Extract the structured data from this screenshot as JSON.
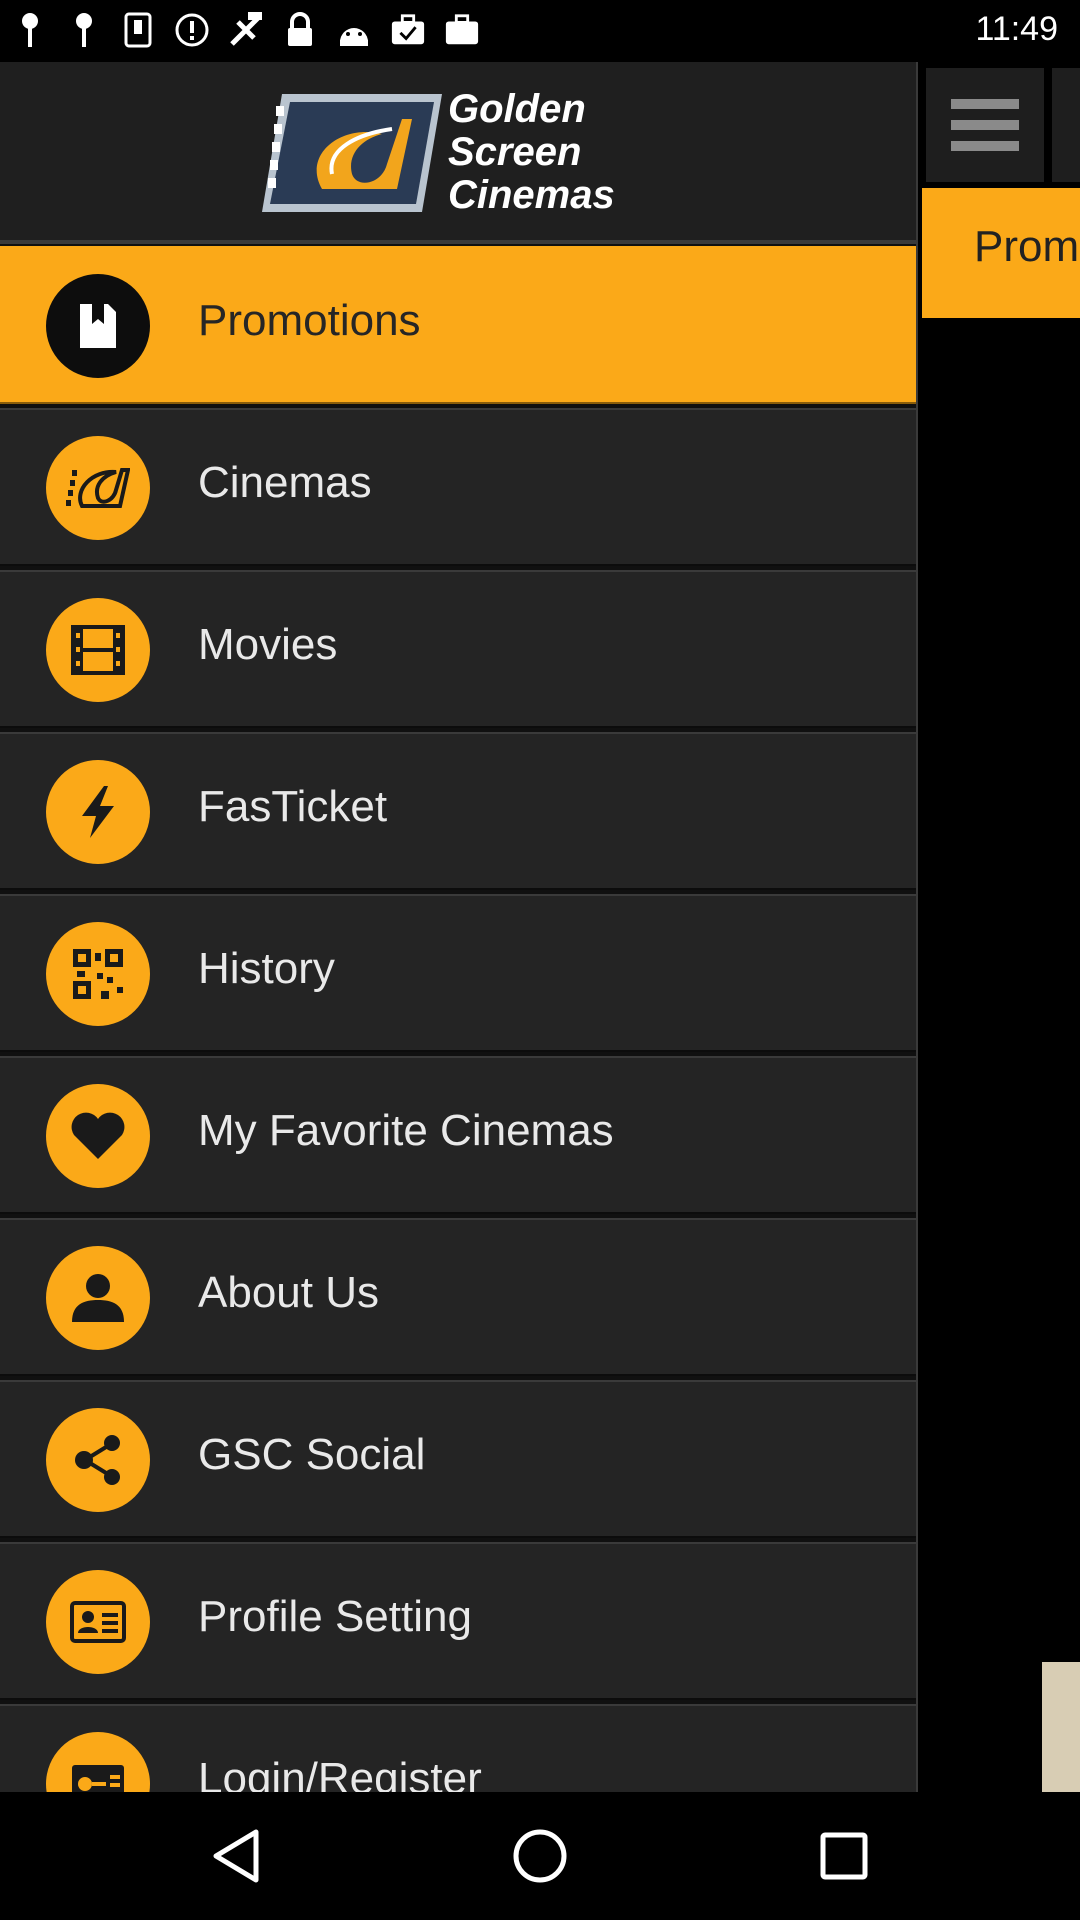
{
  "status_bar": {
    "time": "11:49",
    "icons": [
      "pin-icon",
      "pin-icon",
      "usb-icon",
      "info-icon",
      "fake-gps-icon",
      "lock-icon",
      "android-icon",
      "briefcase-check-icon",
      "briefcase-icon"
    ]
  },
  "drawer": {
    "logo_lines": [
      "Golden",
      "Screen",
      "Cinemas"
    ],
    "items": [
      {
        "label": "Promotions",
        "icon": "promotion-tag-icon",
        "active": true
      },
      {
        "label": "Cinemas",
        "icon": "gsc-logo-icon",
        "active": false
      },
      {
        "label": "Movies",
        "icon": "film-strip-icon",
        "active": false
      },
      {
        "label": "FasTicket",
        "icon": "lightning-icon",
        "active": false
      },
      {
        "label": "History",
        "icon": "qr-code-icon",
        "active": false
      },
      {
        "label": "My Favorite Cinemas",
        "icon": "heart-icon",
        "active": false
      },
      {
        "label": "About Us",
        "icon": "person-icon",
        "active": false
      },
      {
        "label": "GSC Social",
        "icon": "share-icon",
        "active": false
      },
      {
        "label": "Profile Setting",
        "icon": "id-card-icon",
        "active": false
      },
      {
        "label": "Login/Register",
        "icon": "key-card-icon",
        "active": false
      }
    ]
  },
  "background_app": {
    "tab_label": "Prom"
  },
  "colors": {
    "accent": "#fba918",
    "item_bg": "#242424",
    "header_bg": "#1f1f1f"
  },
  "nav_bar": {
    "buttons": [
      "back-icon",
      "home-icon",
      "recents-icon"
    ]
  }
}
